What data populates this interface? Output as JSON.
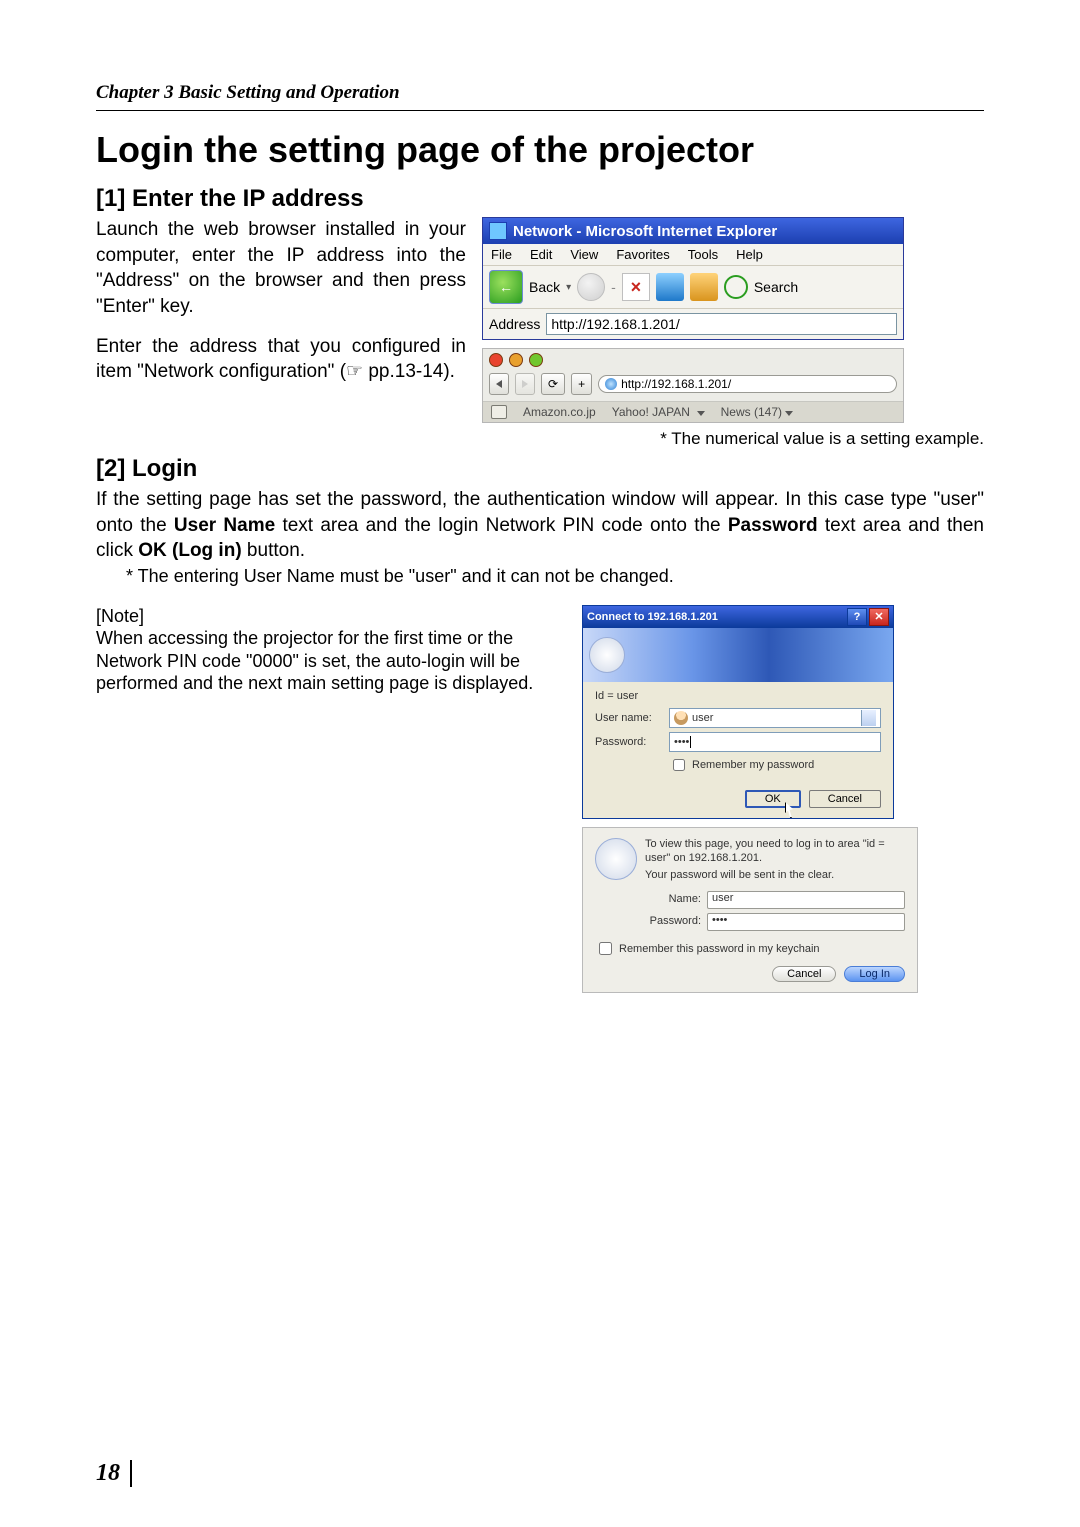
{
  "chapter": "Chapter 3 Basic Setting and Operation",
  "page_number": "18",
  "h1": "Login the setting page of the projector",
  "section1": {
    "heading": "[1] Enter the IP address",
    "p1": "Launch the web browser installed in your computer, enter the IP address into the \"Address\" on the browser and then press \"Enter\" key.",
    "p2": "Enter the address that you configured in item \"Network configuration\" (☞ pp.13-14)."
  },
  "ie": {
    "title": "Network - Microsoft Internet Explorer",
    "menu": [
      "File",
      "Edit",
      "View",
      "Favorites",
      "Tools",
      "Help"
    ],
    "back": "Back",
    "search": "Search",
    "address_label": "Address",
    "url": "http://192.168.1.201/"
  },
  "safari": {
    "url": "http://192.168.1.201/",
    "reload": "⟳",
    "plus": "+",
    "bookmarks": [
      "Amazon.co.jp",
      "Yahoo! JAPAN",
      "News (147)"
    ]
  },
  "footnote": "* The numerical value is a setting example.",
  "section2": {
    "heading": "[2] Login",
    "body_before": "If the setting page has set the password, the authentication window will appear. In this case type \"user\" onto the ",
    "bold_user": "User Name",
    "body_mid1": " text area and the login Network PIN code onto the ",
    "bold_pass": "Password",
    "body_mid2": " text area and then click ",
    "bold_ok": "OK (Log in)",
    "body_after": " button.",
    "indent_note": "* The entering User Name must be \"user\" and it can not be changed."
  },
  "note_block": {
    "header": "[Note]",
    "body": "When accessing the projector for the first time or the Network PIN code \"0000\" is set, the auto-login will be performed and the next main setting page is displayed."
  },
  "auth_win": {
    "title": "Connect to 192.168.1.201",
    "id_line": "Id = user",
    "user_label": "User name:",
    "user_value": "user",
    "pass_label": "Password:",
    "pass_value": "••••",
    "remember": "Remember my password",
    "ok": "OK",
    "cancel": "Cancel"
  },
  "auth_mac": {
    "line1": "To view this page, you need to log in to area \"id = user\" on 192.168.1.201.",
    "line2": "Your password will be sent in the clear.",
    "name_label": "Name:",
    "name_value": "user",
    "pass_label": "Password:",
    "pass_value": "••••",
    "remember": "Remember this password in my keychain",
    "cancel": "Cancel",
    "login": "Log In"
  }
}
